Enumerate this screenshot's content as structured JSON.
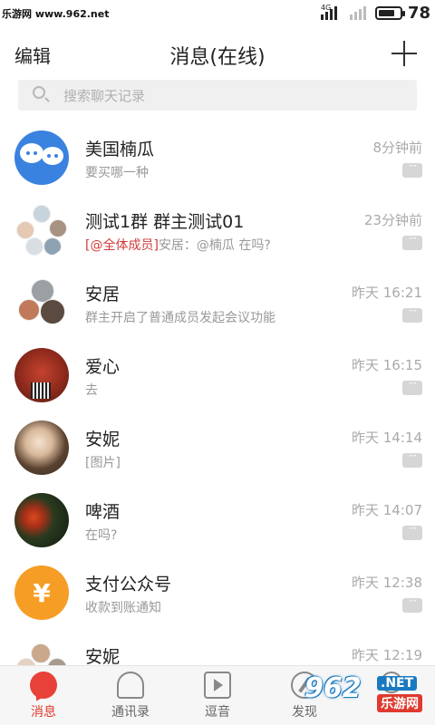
{
  "status_bar": {
    "watermark": "乐游网 www.962.net",
    "network_label": "4G",
    "battery_level": "78",
    "battery_fraction": 0.78
  },
  "header": {
    "edit_label": "编辑",
    "title": "消息(在线)",
    "add_icon": "plus-icon"
  },
  "search": {
    "placeholder": "搜索聊天记录",
    "icon": "search-icon"
  },
  "chats": [
    {
      "name": "美国楠瓜",
      "preview": "要买哪一种",
      "mention": "",
      "time": "8分钟前",
      "avatar": "bubbles-avatar"
    },
    {
      "name": "测试1群 群主测试01",
      "preview": "安居：@楠瓜 在吗?",
      "mention": "[@全体成员]",
      "time": "23分钟前",
      "avatar": "group-avatar"
    },
    {
      "name": "安居",
      "preview": "群主开启了普通成员发起会议功能",
      "mention": "",
      "time": "昨天 16:21",
      "avatar": "group-avatar"
    },
    {
      "name": "爱心",
      "preview": "去",
      "mention": "",
      "time": "昨天 16:15",
      "avatar": "photo-avatar"
    },
    {
      "name": "安妮",
      "preview": "[图片]",
      "mention": "",
      "time": "昨天 14:14",
      "avatar": "photo-avatar"
    },
    {
      "name": "啤酒",
      "preview": "在吗?",
      "mention": "",
      "time": "昨天 14:07",
      "avatar": "photo-avatar"
    },
    {
      "name": "支付公众号",
      "preview": "收款到账通知",
      "mention": "",
      "time": "昨天 12:38",
      "avatar": "yen-icon"
    },
    {
      "name": "安妮",
      "preview": "",
      "mention": "",
      "time": "昨天 12:19",
      "avatar": "group-avatar"
    }
  ],
  "pay_avatar_symbol": "¥",
  "bottom_nav": [
    {
      "label": "消息",
      "icon": "message-icon",
      "active": true
    },
    {
      "label": "通讯录",
      "icon": "contacts-icon",
      "active": false
    },
    {
      "label": "逗音",
      "icon": "video-icon",
      "active": false
    },
    {
      "label": "发现",
      "icon": "compass-icon",
      "active": false
    },
    {
      "label": "",
      "icon": "profile-icon",
      "active": false
    }
  ],
  "site_watermark": {
    "logo": "962",
    "net": ".NET",
    "cn": "乐游网"
  },
  "colors": {
    "accent_red": "#e03a2e",
    "mention_red": "#d23a3a",
    "pay_orange": "#f59d25",
    "avatar_blue": "#3a82e0"
  }
}
